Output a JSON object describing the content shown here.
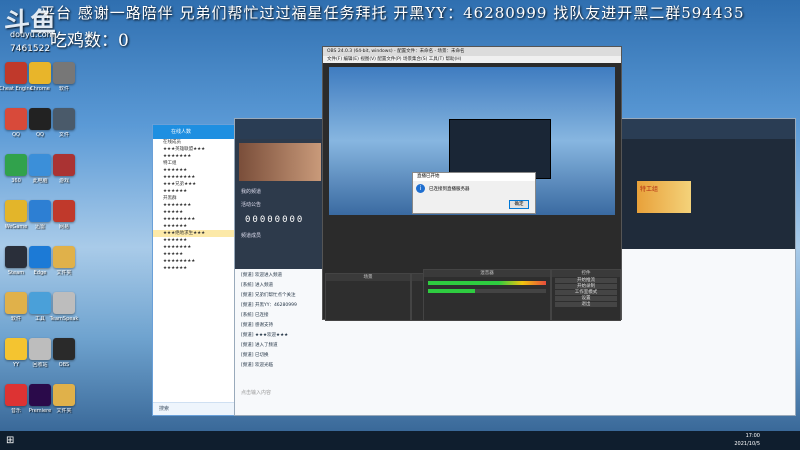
{
  "overlay": {
    "ticker": "平台 感谢一路陪伴  兄弟们帮忙过过福星任务拜托  开黑YY：46280999  找队友进开黑二群594435",
    "logo_text": "斗鱼",
    "logo_sub": "douyu.com",
    "room_id": "7461522",
    "counter": "吃鸡数：0"
  },
  "desktop_icons": [
    {
      "label": "Cheat Engine",
      "color": "#c0392b",
      "icon": "app-icon"
    },
    {
      "label": "Chrome",
      "color": "#e8b52a",
      "icon": "chrome-icon"
    },
    {
      "label": "软件",
      "color": "#777777",
      "icon": "app-icon"
    },
    {
      "label": "QQ",
      "color": "#d84a3a",
      "icon": "qq-icon"
    },
    {
      "label": "QQ",
      "color": "#222222",
      "icon": "qq-icon"
    },
    {
      "label": "文件",
      "color": "#4a5a6a",
      "icon": "app-icon"
    },
    {
      "label": "360",
      "color": "#31a24c",
      "icon": "app-icon"
    },
    {
      "label": "此电脑",
      "color": "#3b8fd9",
      "icon": "computer-icon"
    },
    {
      "label": "游戏",
      "color": "#a33",
      "icon": "app-icon"
    },
    {
      "label": "WeGame",
      "color": "#e3b52a",
      "icon": "game-icon"
    },
    {
      "label": "迅雷",
      "color": "#2d7fd3",
      "icon": "app-icon"
    },
    {
      "label": "网易",
      "color": "#c0392b",
      "icon": "app-icon"
    },
    {
      "label": "Steam",
      "color": "#2a2f3a",
      "icon": "steam-icon"
    },
    {
      "label": "Edge",
      "color": "#1c7ad6",
      "icon": "edge-icon"
    },
    {
      "label": "文件夹",
      "color": "#e0b14a",
      "icon": "folder-icon"
    },
    {
      "label": "软件",
      "color": "#e0b14a",
      "icon": "folder-icon"
    },
    {
      "label": "工具",
      "color": "#4aa0d9",
      "icon": "app-icon"
    },
    {
      "label": "TeamSpeak",
      "color": "#bdbdbd",
      "icon": "app-icon"
    },
    {
      "label": "YY",
      "color": "#f4c430",
      "icon": "yy-icon"
    },
    {
      "label": "回收站",
      "color": "#bdbdbd",
      "icon": "recycle-bin-icon"
    },
    {
      "label": "OBS",
      "color": "#2a2a2a",
      "icon": "obs-icon"
    },
    {
      "label": "音乐",
      "color": "#d33",
      "icon": "music-icon"
    },
    {
      "label": "Premiere",
      "color": "#2a0a4a",
      "icon": "premiere-icon"
    },
    {
      "label": "文件夹",
      "color": "#e0b14a",
      "icon": "folder-icon"
    }
  ],
  "qq": {
    "title": "在线人数",
    "items": [
      "在线成员",
      "★★★英雄联盟★★★",
      "★★★★★★★",
      "特工组",
      "★★★★★★",
      "★★★★★★★★",
      "★★★兄弟★★★",
      "★★★★★★",
      "开黑群",
      "★★★★★★★",
      "★★★★★",
      "★★★★★★★★",
      "★★★★★★",
      "★★★绝地求生★★★",
      "★★★★★★",
      "★★★★★★★",
      "★★★★★",
      "★★★★★★★★",
      "★★★★★★"
    ],
    "bottom": "搜索"
  },
  "chat": {
    "room_label": "直播间",
    "panel_labels": [
      "我的频道",
      "活动公告",
      "频道成员"
    ],
    "sequence_number": "00000000",
    "messages": [
      "[频道] 欢迎进入频道",
      "[系统] 进入频道",
      "[频道] 兄弟们帮忙点个关注",
      "[频道] 开黑YY：46280999",
      "[系统] 已连接",
      "[频道] 感谢支持",
      "[频道] ★★★欢迎★★★",
      "[频道] 进入了频道",
      "[频道] 已切换",
      "[频道] 欢迎光临"
    ],
    "input_placeholder": "点击输入内容",
    "right_banner": "特工组"
  },
  "obs": {
    "title": "OBS 24.0.3 (64-bit, windows) - 配置文件：未命名 - 场景：未命名",
    "menu": "文件(F)  编辑(E)  视图(V)  配置文件(P)  场景集合(S)  工具(T)  帮助(H)",
    "panels": {
      "scenes": "场景",
      "sources": "来源",
      "mixer": "混音器",
      "transitions": "转场特效",
      "controls": "控件"
    },
    "controls": [
      "开始推流",
      "开始录制",
      "工作室模式",
      "设置",
      "退出"
    ],
    "dialog_title": "直播已开始",
    "dialog_text": "已连接到直播服务器",
    "dialog_ok": "确定"
  },
  "taskbar": {
    "time": "17:00",
    "date": "2021/10/5"
  }
}
